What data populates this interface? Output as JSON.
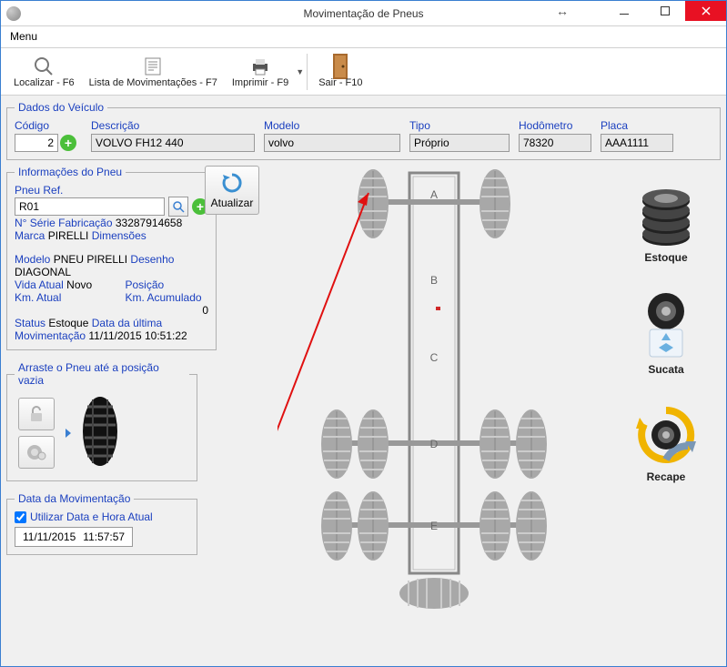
{
  "window": {
    "title": "Movimentação de Pneus",
    "menu_label": "Menu"
  },
  "toolbar": {
    "localizar": "Localizar - F6",
    "lista": "Lista de Movimentações - F7",
    "imprimir": "Imprimir - F9",
    "sair": "Sair - F10"
  },
  "vehicle": {
    "legend": "Dados do Veículo",
    "codigo_label": "Código",
    "codigo": "2",
    "descricao_label": "Descrição",
    "descricao": "VOLVO FH12 440",
    "modelo_label": "Modelo",
    "modelo": "volvo",
    "tipo_label": "Tipo",
    "tipo": "Próprio",
    "hodometro_label": "Hodômetro",
    "hodometro": "78320",
    "placa_label": "Placa",
    "placa": "AAA1111"
  },
  "tire_info": {
    "legend": "Informações do Pneu",
    "pneu_ref_label": "Pneu Ref.",
    "pneu_ref": "R01",
    "serie_label": "N° Série Fabricação",
    "serie": "33287914658",
    "marca_label": "Marca",
    "marca": "PIRELLI",
    "dimensoes_label": "Dimensões",
    "dimensoes": "",
    "modelo_label": "Modelo",
    "modelo": "PNEU PIRELLI",
    "desenho_label": "Desenho",
    "desenho": "DIAGONAL",
    "vida_atual_label": "Vida Atual",
    "vida_atual": "Novo",
    "posicao_label": "Posição",
    "posicao": "",
    "km_atual_label": "Km. Atual",
    "km_atual": "",
    "km_acum_label": "Km. Acumulado",
    "km_acum": "0",
    "status_label": "Status",
    "status": "Estoque",
    "ultima_mov_label": "Data da última Movimentação",
    "ultima_mov": "11/11/2015 10:51:22"
  },
  "update_btn": "Atualizar",
  "drag": {
    "legend": "Arraste o Pneu até a posição vazia"
  },
  "mov_date": {
    "legend": "Data da Movimentação",
    "checkbox_label": "Utilizar Data e Hora Atual",
    "date": "11/11/2015",
    "time": "11:57:57"
  },
  "axles": {
    "a": "A",
    "b": "B",
    "c": "C",
    "d": "D",
    "e": "E"
  },
  "destinations": {
    "estoque": "Estoque",
    "sucata": "Sucata",
    "recape": "Recape"
  }
}
